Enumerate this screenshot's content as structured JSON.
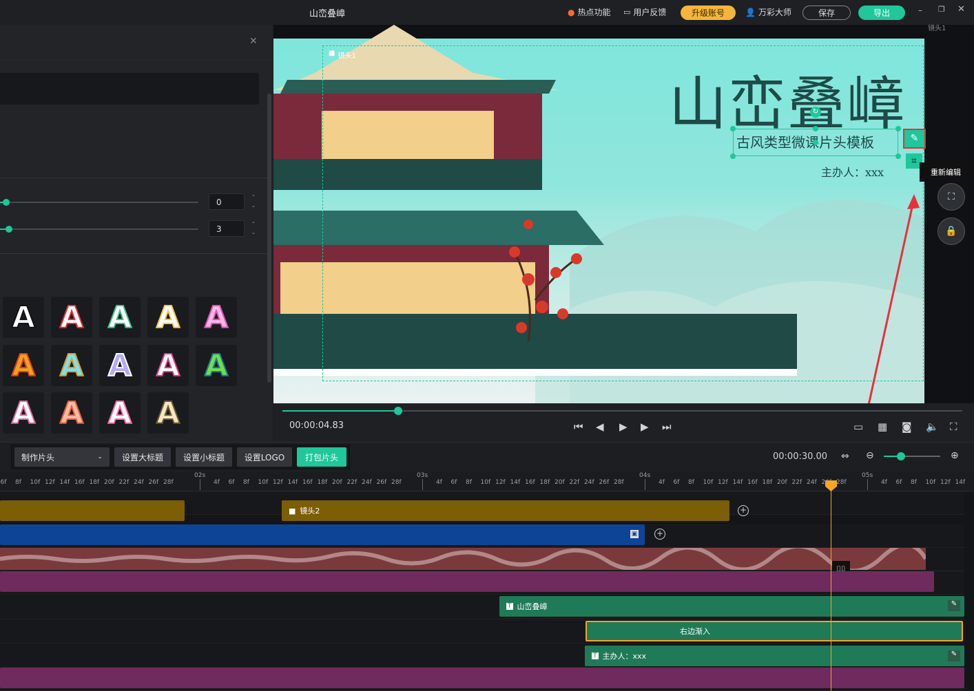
{
  "titlebar": {
    "title": "山峦叠嶂",
    "hot_features": "热点功能",
    "feedback": "用户反馈",
    "upgrade": "升级账号",
    "username": "万彩大师",
    "save": "保存",
    "export": "导出"
  },
  "left_panel": {
    "slider1_value": "0",
    "slider2_value": "3",
    "swatches_row1": [
      "A",
      "A",
      "A",
      "A",
      "A"
    ],
    "swatches_row2": [
      "A",
      "A",
      "A",
      "A",
      "A"
    ],
    "swatches_row3": [
      "A",
      "A",
      "A",
      "A"
    ]
  },
  "preview": {
    "title_text": "山峦叠嶂",
    "subtitle_text": "古风类型微课片头模板",
    "host_text": "主办人：xxx",
    "camera_label": "镜头1",
    "corner_label": "镜头1",
    "tooltip": "重新编辑"
  },
  "player": {
    "current_time": "00:00:04.83",
    "progress": 0.17
  },
  "toolbar": {
    "mode_select": "制作片头",
    "set_title": "设置大标题",
    "set_subtitle": "设置小标题",
    "set_logo": "设置LOGO",
    "pack_intro": "打包片头",
    "total_time": "00:00:30.00",
    "zoom_level": 0.3
  },
  "ruler": {
    "second_labels": [
      "02s",
      "03s",
      "04s",
      "05s"
    ],
    "frame_labels": [
      "4f",
      "6f",
      "8f",
      "10f",
      "12f",
      "14f",
      "16f",
      "18f",
      "20f",
      "22f",
      "24f",
      "26f",
      "28f"
    ]
  },
  "timeline": {
    "clip_camera2": "镜头2",
    "clip_title": "山峦叠嶂",
    "clip_effect": "右边渐入",
    "clip_host": "主办人：xxx"
  },
  "colors": {
    "accent": "#1fc79a",
    "upgrade": "#f5b53a",
    "camera_track": "#7b5e06",
    "blue_track": "#0d4496",
    "audio_track": "#7a3a3c",
    "purple_track": "#6f2a5e",
    "green_track": "#1f7a58",
    "playhead": "#f5a623",
    "highlight_red": "#e8313a"
  }
}
